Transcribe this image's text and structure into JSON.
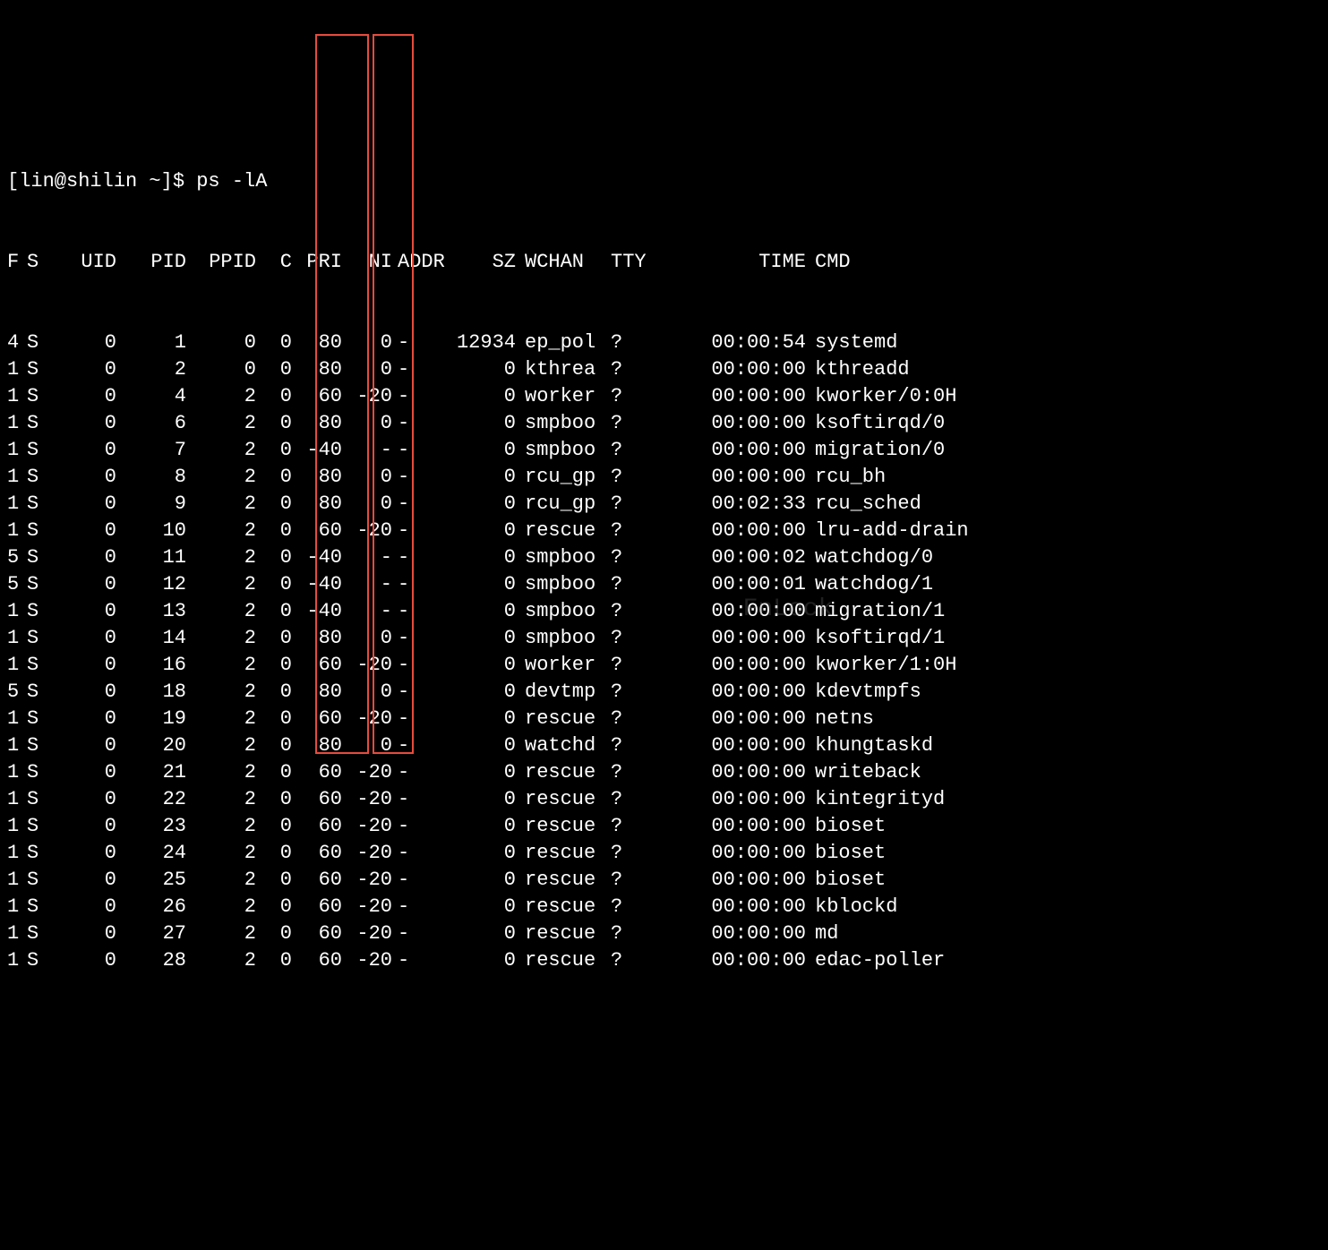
{
  "prompt": "[lin@shilin ~]$ ps -lA",
  "watermark": "FnLock",
  "headers": {
    "F": "F",
    "S": "S",
    "UID": "UID",
    "PID": "PID",
    "PPID": "PPID",
    "C": "C",
    "PRI": "PRI",
    "NI": "NI",
    "ADDR": "ADDR",
    "SZ": "SZ",
    "WCHAN": "WCHAN",
    "TTY": "TTY",
    "TIME": "TIME",
    "CMD": "CMD"
  },
  "rows": [
    {
      "F": "4",
      "S": "S",
      "UID": "0",
      "PID": "1",
      "PPID": "0",
      "C": "0",
      "PRI": "80",
      "NI": "0",
      "ADDR": "-",
      "SZ": "12934",
      "WCHAN": "ep_pol",
      "TTY": "?",
      "TIME": "00:00:54",
      "CMD": "systemd"
    },
    {
      "F": "1",
      "S": "S",
      "UID": "0",
      "PID": "2",
      "PPID": "0",
      "C": "0",
      "PRI": "80",
      "NI": "0",
      "ADDR": "-",
      "SZ": "0",
      "WCHAN": "kthrea",
      "TTY": "?",
      "TIME": "00:00:00",
      "CMD": "kthreadd"
    },
    {
      "F": "1",
      "S": "S",
      "UID": "0",
      "PID": "4",
      "PPID": "2",
      "C": "0",
      "PRI": "60",
      "NI": "-20",
      "ADDR": "-",
      "SZ": "0",
      "WCHAN": "worker",
      "TTY": "?",
      "TIME": "00:00:00",
      "CMD": "kworker/0:0H"
    },
    {
      "F": "1",
      "S": "S",
      "UID": "0",
      "PID": "6",
      "PPID": "2",
      "C": "0",
      "PRI": "80",
      "NI": "0",
      "ADDR": "-",
      "SZ": "0",
      "WCHAN": "smpboo",
      "TTY": "?",
      "TIME": "00:00:00",
      "CMD": "ksoftirqd/0"
    },
    {
      "F": "1",
      "S": "S",
      "UID": "0",
      "PID": "7",
      "PPID": "2",
      "C": "0",
      "PRI": "-40",
      "NI": "-",
      "ADDR": "-",
      "SZ": "0",
      "WCHAN": "smpboo",
      "TTY": "?",
      "TIME": "00:00:00",
      "CMD": "migration/0"
    },
    {
      "F": "1",
      "S": "S",
      "UID": "0",
      "PID": "8",
      "PPID": "2",
      "C": "0",
      "PRI": "80",
      "NI": "0",
      "ADDR": "-",
      "SZ": "0",
      "WCHAN": "rcu_gp",
      "TTY": "?",
      "TIME": "00:00:00",
      "CMD": "rcu_bh"
    },
    {
      "F": "1",
      "S": "S",
      "UID": "0",
      "PID": "9",
      "PPID": "2",
      "C": "0",
      "PRI": "80",
      "NI": "0",
      "ADDR": "-",
      "SZ": "0",
      "WCHAN": "rcu_gp",
      "TTY": "?",
      "TIME": "00:02:33",
      "CMD": "rcu_sched"
    },
    {
      "F": "1",
      "S": "S",
      "UID": "0",
      "PID": "10",
      "PPID": "2",
      "C": "0",
      "PRI": "60",
      "NI": "-20",
      "ADDR": "-",
      "SZ": "0",
      "WCHAN": "rescue",
      "TTY": "?",
      "TIME": "00:00:00",
      "CMD": "lru-add-drain"
    },
    {
      "F": "5",
      "S": "S",
      "UID": "0",
      "PID": "11",
      "PPID": "2",
      "C": "0",
      "PRI": "-40",
      "NI": "-",
      "ADDR": "-",
      "SZ": "0",
      "WCHAN": "smpboo",
      "TTY": "?",
      "TIME": "00:00:02",
      "CMD": "watchdog/0"
    },
    {
      "F": "5",
      "S": "S",
      "UID": "0",
      "PID": "12",
      "PPID": "2",
      "C": "0",
      "PRI": "-40",
      "NI": "-",
      "ADDR": "-",
      "SZ": "0",
      "WCHAN": "smpboo",
      "TTY": "?",
      "TIME": "00:00:01",
      "CMD": "watchdog/1"
    },
    {
      "F": "1",
      "S": "S",
      "UID": "0",
      "PID": "13",
      "PPID": "2",
      "C": "0",
      "PRI": "-40",
      "NI": "-",
      "ADDR": "-",
      "SZ": "0",
      "WCHAN": "smpboo",
      "TTY": "?",
      "TIME": "00:00:00",
      "CMD": "migration/1"
    },
    {
      "F": "1",
      "S": "S",
      "UID": "0",
      "PID": "14",
      "PPID": "2",
      "C": "0",
      "PRI": "80",
      "NI": "0",
      "ADDR": "-",
      "SZ": "0",
      "WCHAN": "smpboo",
      "TTY": "?",
      "TIME": "00:00:00",
      "CMD": "ksoftirqd/1"
    },
    {
      "F": "1",
      "S": "S",
      "UID": "0",
      "PID": "16",
      "PPID": "2",
      "C": "0",
      "PRI": "60",
      "NI": "-20",
      "ADDR": "-",
      "SZ": "0",
      "WCHAN": "worker",
      "TTY": "?",
      "TIME": "00:00:00",
      "CMD": "kworker/1:0H"
    },
    {
      "F": "5",
      "S": "S",
      "UID": "0",
      "PID": "18",
      "PPID": "2",
      "C": "0",
      "PRI": "80",
      "NI": "0",
      "ADDR": "-",
      "SZ": "0",
      "WCHAN": "devtmp",
      "TTY": "?",
      "TIME": "00:00:00",
      "CMD": "kdevtmpfs"
    },
    {
      "F": "1",
      "S": "S",
      "UID": "0",
      "PID": "19",
      "PPID": "2",
      "C": "0",
      "PRI": "60",
      "NI": "-20",
      "ADDR": "-",
      "SZ": "0",
      "WCHAN": "rescue",
      "TTY": "?",
      "TIME": "00:00:00",
      "CMD": "netns"
    },
    {
      "F": "1",
      "S": "S",
      "UID": "0",
      "PID": "20",
      "PPID": "2",
      "C": "0",
      "PRI": "80",
      "NI": "0",
      "ADDR": "-",
      "SZ": "0",
      "WCHAN": "watchd",
      "TTY": "?",
      "TIME": "00:00:00",
      "CMD": "khungtaskd"
    },
    {
      "F": "1",
      "S": "S",
      "UID": "0",
      "PID": "21",
      "PPID": "2",
      "C": "0",
      "PRI": "60",
      "NI": "-20",
      "ADDR": "-",
      "SZ": "0",
      "WCHAN": "rescue",
      "TTY": "?",
      "TIME": "00:00:00",
      "CMD": "writeback"
    },
    {
      "F": "1",
      "S": "S",
      "UID": "0",
      "PID": "22",
      "PPID": "2",
      "C": "0",
      "PRI": "60",
      "NI": "-20",
      "ADDR": "-",
      "SZ": "0",
      "WCHAN": "rescue",
      "TTY": "?",
      "TIME": "00:00:00",
      "CMD": "kintegrityd"
    },
    {
      "F": "1",
      "S": "S",
      "UID": "0",
      "PID": "23",
      "PPID": "2",
      "C": "0",
      "PRI": "60",
      "NI": "-20",
      "ADDR": "-",
      "SZ": "0",
      "WCHAN": "rescue",
      "TTY": "?",
      "TIME": "00:00:00",
      "CMD": "bioset"
    },
    {
      "F": "1",
      "S": "S",
      "UID": "0",
      "PID": "24",
      "PPID": "2",
      "C": "0",
      "PRI": "60",
      "NI": "-20",
      "ADDR": "-",
      "SZ": "0",
      "WCHAN": "rescue",
      "TTY": "?",
      "TIME": "00:00:00",
      "CMD": "bioset"
    },
    {
      "F": "1",
      "S": "S",
      "UID": "0",
      "PID": "25",
      "PPID": "2",
      "C": "0",
      "PRI": "60",
      "NI": "-20",
      "ADDR": "-",
      "SZ": "0",
      "WCHAN": "rescue",
      "TTY": "?",
      "TIME": "00:00:00",
      "CMD": "bioset"
    },
    {
      "F": "1",
      "S": "S",
      "UID": "0",
      "PID": "26",
      "PPID": "2",
      "C": "0",
      "PRI": "60",
      "NI": "-20",
      "ADDR": "-",
      "SZ": "0",
      "WCHAN": "rescue",
      "TTY": "?",
      "TIME": "00:00:00",
      "CMD": "kblockd"
    },
    {
      "F": "1",
      "S": "S",
      "UID": "0",
      "PID": "27",
      "PPID": "2",
      "C": "0",
      "PRI": "60",
      "NI": "-20",
      "ADDR": "-",
      "SZ": "0",
      "WCHAN": "rescue",
      "TTY": "?",
      "TIME": "00:00:00",
      "CMD": "md"
    },
    {
      "F": "1",
      "S": "S",
      "UID": "0",
      "PID": "28",
      "PPID": "2",
      "C": "0",
      "PRI": "60",
      "NI": "-20",
      "ADDR": "-",
      "SZ": "0",
      "WCHAN": "rescue",
      "TTY": "?",
      "TIME": "00:00:00",
      "CMD": "edac-poller"
    }
  ]
}
